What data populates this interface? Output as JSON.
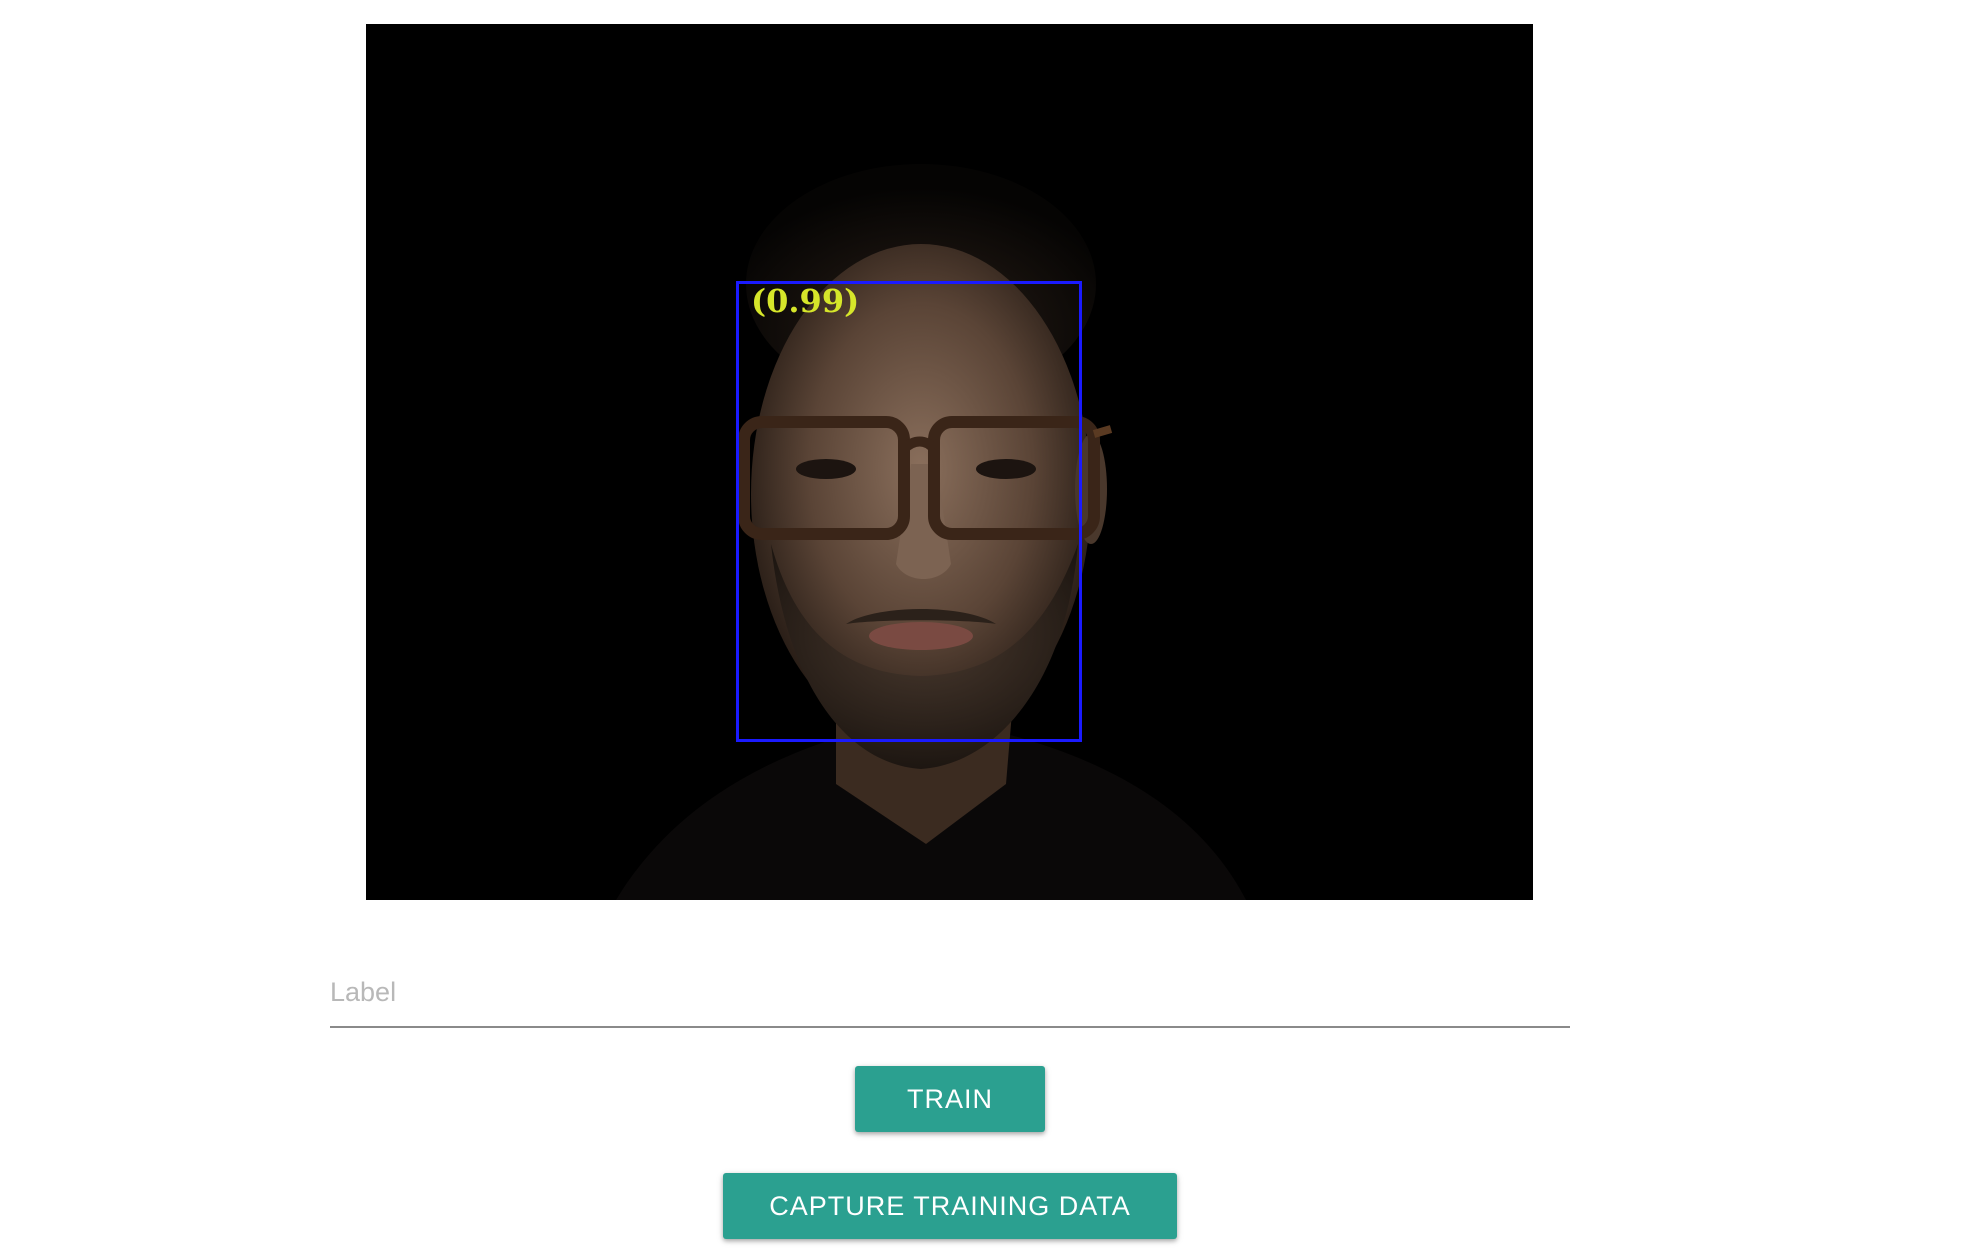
{
  "video": {
    "detection": {
      "confidence_text": "(0.99)",
      "box_color": "#1a1aff",
      "text_color": "#d6e62a"
    }
  },
  "form": {
    "label_placeholder": "Label",
    "label_value": ""
  },
  "buttons": {
    "train_label": "TRAIN",
    "capture_label": "CAPTURE TRAINING DATA",
    "color": "#2ba090"
  }
}
